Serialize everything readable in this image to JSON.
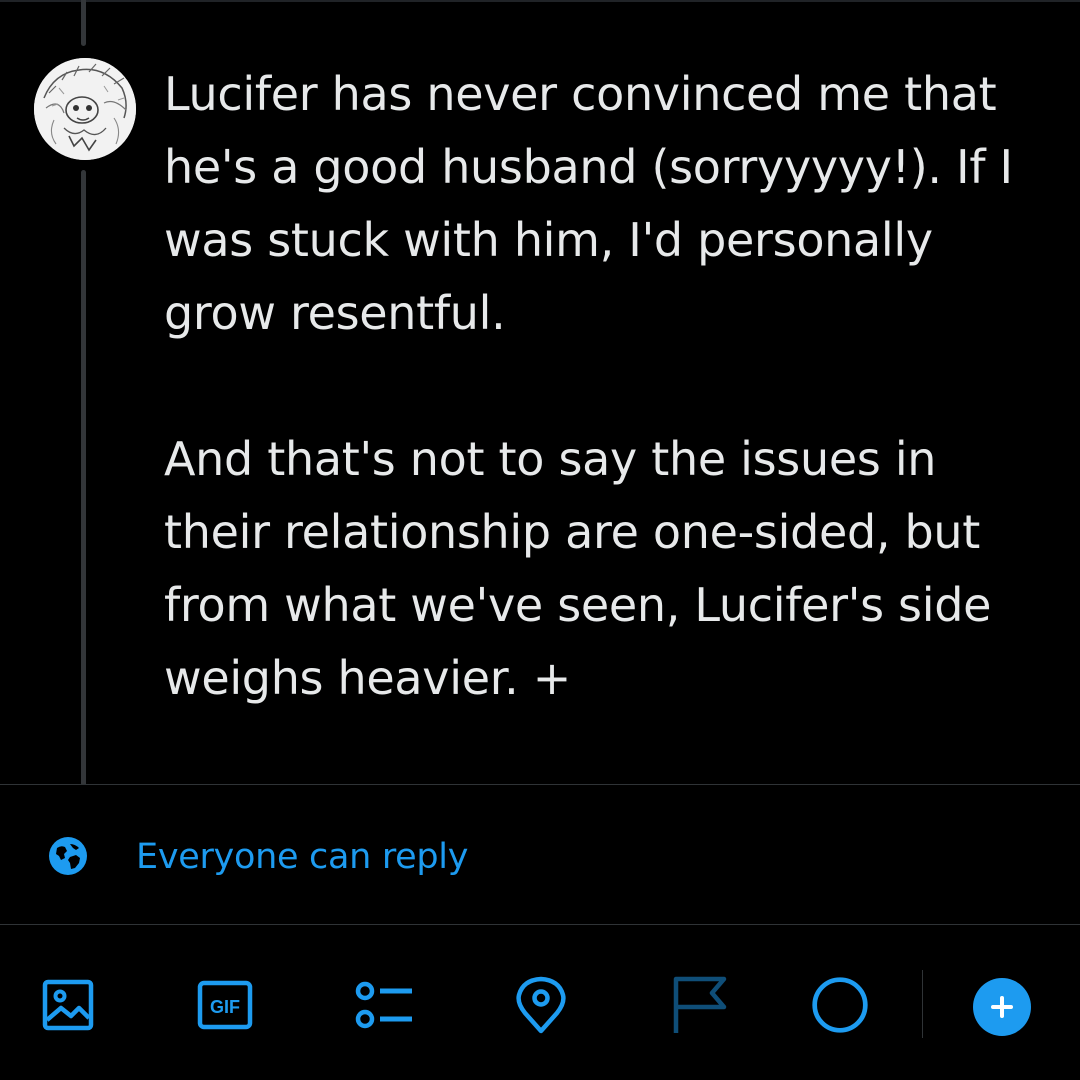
{
  "compose": {
    "paragraph1": "Lucifer has never convinced me that\nhe's a good husband (sorryyyyy!). If I\nwas stuck with him, I'd personally\ngrow resentful.",
    "paragraph2": "And that's not to say the issues in\ntheir relationship are one-sided, but\nfrom what we've seen, Lucifer's side\nweighs heavier. +"
  },
  "reply_setting": {
    "label": "Everyone can reply",
    "icon": "globe-icon"
  },
  "toolbar": {
    "items": [
      {
        "name": "media-icon"
      },
      {
        "name": "gif-icon",
        "text": "GIF"
      },
      {
        "name": "poll-icon"
      },
      {
        "name": "location-icon"
      },
      {
        "name": "flag-icon"
      },
      {
        "name": "character-count-icon"
      },
      {
        "name": "add-post-icon"
      }
    ]
  },
  "colors": {
    "background": "#000000",
    "text": "#e7e9ea",
    "accent": "#1d9bf0",
    "accent_dim": "#0f4e78",
    "divider": "#2f3336"
  }
}
